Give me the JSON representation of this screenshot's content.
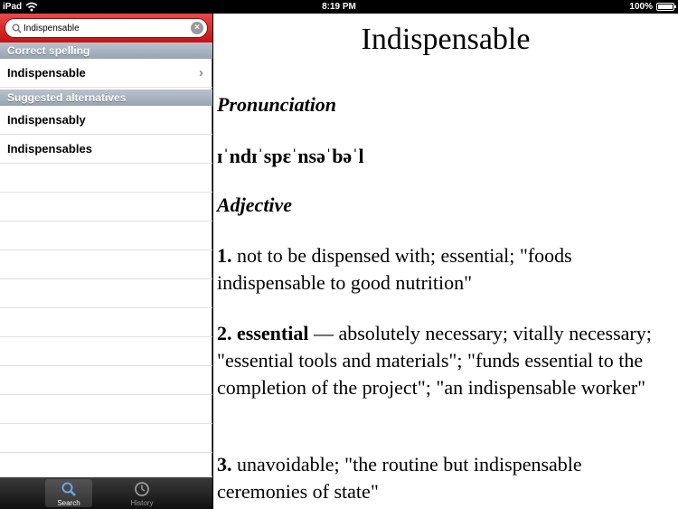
{
  "status_bar": {
    "carrier": "iPad",
    "time": "8:19 PM",
    "battery": "100%",
    "battery_level": 1.0
  },
  "search": {
    "value": "Indispensable",
    "placeholder": ""
  },
  "sidebar": {
    "correct_header": "Correct spelling",
    "correct_item": "Indispensable",
    "alternatives_header": "Suggested alternatives",
    "alternatives": [
      "Indispensably",
      "Indispensables"
    ]
  },
  "tabs": [
    {
      "label": "Search",
      "icon": "magnifier-icon",
      "active": true
    },
    {
      "label": "History",
      "icon": "clock-icon",
      "active": false
    }
  ],
  "entry": {
    "word": "Indispensable",
    "pronunciation_heading": "Pronunciation",
    "pronunciation": "ɪˈndɪˈspɛˈnsəˈbəˈl",
    "pos": "Adjective",
    "definitions": [
      {
        "num": "1.",
        "term": "",
        "text": " not to be dispensed with; essential; \"foods indispensable to good nutrition\""
      },
      {
        "num": "2.",
        "term": " essential",
        "text": " — absolutely necessary; vitally necessary; \"essential tools and materials\"; \"funds essential to the completion of the project\"; \"an indispensable worker\""
      },
      {
        "num": "3.",
        "term": "",
        "text": " unavoidable; \"the routine but indispensable ceremonies of state\""
      }
    ]
  },
  "colors": {
    "search_bar": "#d42020",
    "section_header": "#a6b2be",
    "tabbar": "#222222"
  }
}
